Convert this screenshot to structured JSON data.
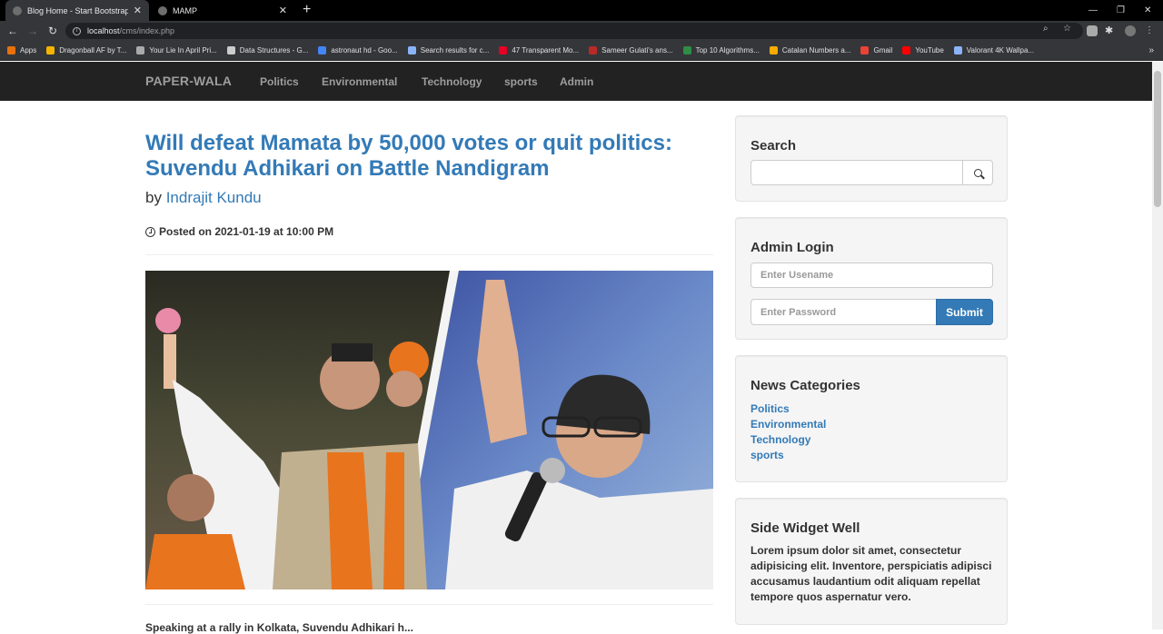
{
  "browser": {
    "tabs": [
      {
        "label": "Blog Home - Start Bootstrap Tem",
        "close": "✕"
      },
      {
        "label": "MAMP",
        "close": "✕"
      }
    ],
    "new_tab": "+",
    "window_controls": {
      "minimize": "—",
      "restore": "❐",
      "close": "✕"
    },
    "nav": {
      "back": "←",
      "forward": "→",
      "reload": "↻"
    },
    "url_host": "localhost",
    "url_path": "/cms/index.php",
    "bookmarks": [
      {
        "label": "Apps",
        "color": "#e8710a"
      },
      {
        "label": "Dragonball AF by T...",
        "color": "#f4b400"
      },
      {
        "label": "Your Lie In April Pri...",
        "color": "#aaaaaa"
      },
      {
        "label": "Data Structures - G...",
        "color": "#cccccc"
      },
      {
        "label": "astronaut hd - Goo...",
        "color": "#4285f4"
      },
      {
        "label": "Search results for c...",
        "color": "#8ab4f8"
      },
      {
        "label": "47 Transparent Mo...",
        "color": "#e60023"
      },
      {
        "label": "Sameer Gulati's ans...",
        "color": "#b92b27"
      },
      {
        "label": "Top 10 Algorithms...",
        "color": "#2f8d46"
      },
      {
        "label": "Catalan Numbers a...",
        "color": "#f9ab00"
      },
      {
        "label": "Gmail",
        "color": "#ea4335"
      },
      {
        "label": "YouTube",
        "color": "#ff0000"
      },
      {
        "label": "Valorant 4K Wallpa...",
        "color": "#8ab4f8"
      }
    ],
    "bookmarks_more": "»"
  },
  "site": {
    "brand": "PAPER-WALA",
    "nav": [
      "Politics",
      "Environmental",
      "Technology",
      "sports",
      "Admin"
    ]
  },
  "post": {
    "title": "Will defeat Mamata by 50,000 votes or quit politics: Suvendu Adhikari on Battle Nandigram",
    "by": "by",
    "author": "Indrajit Kundu",
    "posted_on": "Posted on 2021-01-19 at 10:00 PM",
    "excerpt": "Speaking at a rally in Kolkata, Suvendu Adhikari h..."
  },
  "sidebar": {
    "search_title": "Search",
    "login_title": "Admin Login",
    "username_placeholder": "Enter Usename",
    "password_placeholder": "Enter Password",
    "submit_label": "Submit",
    "categories_title": "News Categories",
    "categories": [
      "Politics",
      "Environmental",
      "Technology",
      "sports"
    ],
    "widget_title": "Side Widget Well",
    "widget_text": "Lorem ipsum dolor sit amet, consectetur adipisicing elit. Inventore, perspiciatis adipisci accusamus laudantium odit aliquam repellat tempore quos aspernatur vero."
  },
  "colors": {
    "link": "#337ab7",
    "navbar": "#222222",
    "well": "#f5f5f5"
  }
}
